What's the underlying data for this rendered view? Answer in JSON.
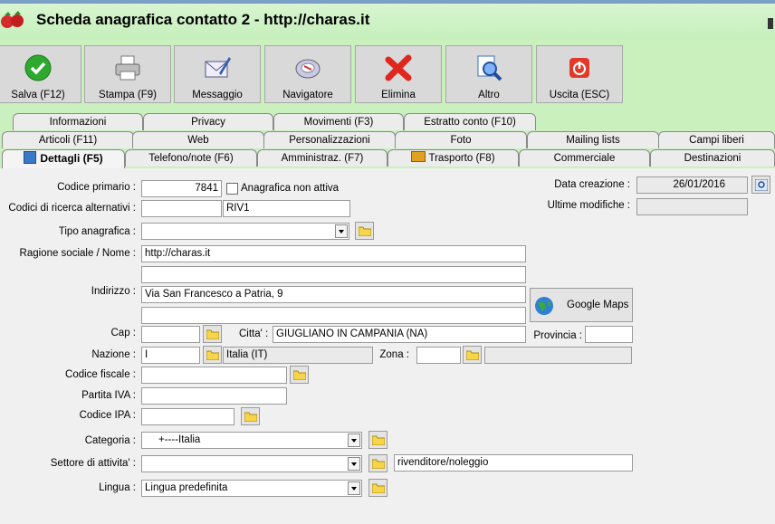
{
  "window": {
    "title": "Scheda anagrafica contatto 2 - http://charas.it"
  },
  "toolbar": [
    {
      "label": "Salva (F12)",
      "icon": "check-icon"
    },
    {
      "label": "Stampa (F9)",
      "icon": "printer-icon"
    },
    {
      "label": "Messaggio",
      "icon": "mail-icon"
    },
    {
      "label": "Navigatore",
      "icon": "navigator-icon"
    },
    {
      "label": "Elimina",
      "icon": "delete-icon"
    },
    {
      "label": "Altro",
      "icon": "search-doc-icon"
    },
    {
      "label": "Uscita (ESC)",
      "icon": "power-icon"
    }
  ],
  "tabs": {
    "row1": [
      "Informazioni",
      "Privacy",
      "Movimenti (F3)",
      "Estratto conto (F10)"
    ],
    "row2": [
      "Articoli (F11)",
      "Web",
      "Personalizzazioni",
      "Foto",
      "Mailing lists",
      "Campi liberi"
    ],
    "row3": [
      "Dettagli (F5)",
      "Telefono/note (F6)",
      "Amministraz. (F7)",
      "Trasporto (F8)",
      "Commerciale",
      "Destinazioni"
    ],
    "active": "Dettagli (F5)"
  },
  "form": {
    "codice_primario": {
      "label": "Codice primario :",
      "value": "7841"
    },
    "non_attiva": {
      "label": "Anagrafica non attiva",
      "checked": false
    },
    "codici_alt": {
      "label": "Codici di ricerca alternativi :",
      "value1": "",
      "value2": "RIV1"
    },
    "tipo": {
      "label": "Tipo anagrafica :",
      "value": ""
    },
    "ragione": {
      "label": "Ragione sociale / Nome :",
      "value1": "http://charas.it",
      "value2": ""
    },
    "indirizzo": {
      "label": "Indirizzo :",
      "value1": "Via San Francesco a Patria, 9",
      "value2": ""
    },
    "cap": {
      "label": "Cap :",
      "value": ""
    },
    "citta": {
      "label": "Citta' :",
      "value": "GIUGLIANO IN CAMPANIA (NA)"
    },
    "provincia": {
      "label": "Provincia :",
      "value": ""
    },
    "nazione": {
      "label": "Nazione :",
      "code": "I",
      "name": "Italia (IT)"
    },
    "zona": {
      "label": "Zona :",
      "code": "",
      "name": ""
    },
    "codice_fiscale": {
      "label": "Codice fiscale :",
      "value": ""
    },
    "partita_iva": {
      "label": "Partita IVA :",
      "value": ""
    },
    "codice_ipa": {
      "label": "Codice IPA :",
      "value": ""
    },
    "categoria": {
      "label": "Categoria :",
      "value": "+----Italia"
    },
    "settore": {
      "label": "Settore di attivita' :",
      "value": "",
      "desc": "rivenditore/noleggio"
    },
    "lingua": {
      "label": "Lingua :",
      "value": "Lingua predefinita"
    },
    "data_creazione": {
      "label": "Data creazione :",
      "value": "26/01/2016"
    },
    "ultime_modifiche": {
      "label": "Ultime modifiche :",
      "value": ""
    },
    "google_maps": {
      "label": "Google Maps"
    }
  }
}
